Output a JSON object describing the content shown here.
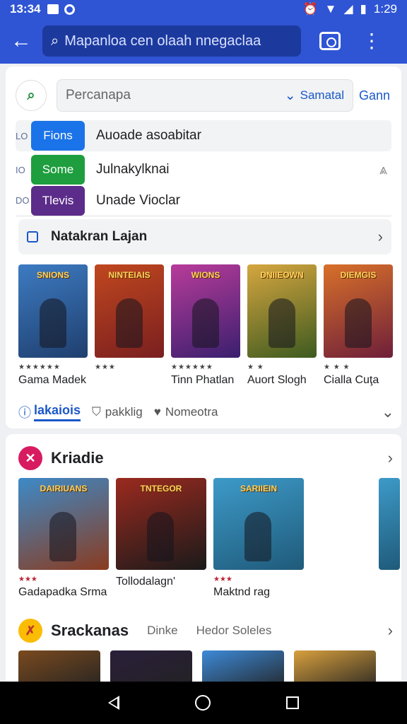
{
  "status": {
    "time": "13:34",
    "battery_time": "1:29"
  },
  "appbar": {
    "search_placeholder": "Mapanloa cen olaah nnegaclaa",
    "icons": [
      "back-arrow-icon",
      "search-icon",
      "camera-icon",
      "more-vert-icon"
    ]
  },
  "filter": {
    "placeholder": "Percanapa",
    "selected": "Samatal",
    "link": "Gann"
  },
  "tags": [
    {
      "mark": "LO",
      "label": "Fions",
      "color": "#1a73e8",
      "text": "Auoade asoabitar"
    },
    {
      "mark": "IO",
      "label": "Some",
      "color": "#1e9e3e",
      "text": "Julnakylknai"
    },
    {
      "mark": "DO",
      "label": "Tlevis",
      "color": "#5b2c8a",
      "text": "Unade Vioclar"
    }
  ],
  "section1": {
    "title": "Natakran Lajan"
  },
  "games1": [
    {
      "art_title": "SNIONS",
      "stars": "★★★★★★",
      "name": "Gama Madek",
      "bg": "#1f3f6e",
      "bg2": "#3d7bc2"
    },
    {
      "art_title": "NINTEIAIS",
      "stars": "★★★",
      "name": "",
      "bg": "#7a1f1f",
      "bg2": "#c0471f"
    },
    {
      "art_title": "WIONS",
      "stars": "★★★★★★",
      "name": "Tinn Phatlan",
      "bg": "#3a1f6e",
      "bg2": "#b83c9a"
    },
    {
      "art_title": "DNIIEOWN",
      "stars": "★ ★",
      "name": "Auort Slogh",
      "bg": "#3d5a1f",
      "bg2": "#d6a640"
    },
    {
      "art_title": "DIEMGIS",
      "stars": "★ ★ ★",
      "name": "Cialla Cuţa",
      "bg": "#6e1f3a",
      "bg2": "#d8702a"
    }
  ],
  "chips": {
    "active": "lakaiois",
    "chip1": "pakklig",
    "chip2": "Nomeotra"
  },
  "section2": {
    "title": "Kriadie",
    "badge": "✕"
  },
  "games2": [
    {
      "art_title": "DAIRIUANS",
      "stars": "★★★",
      "name": "Gadapadka Srma",
      "bg": "#8a3b1f",
      "bg2": "#3d8ac8"
    },
    {
      "art_title": "TNTEGOR",
      "stars": "",
      "name": "Tollodalagn'",
      "bg": "#1a1a1a",
      "bg2": "#9b2a1f"
    },
    {
      "art_title": "SARIIEIN",
      "stars": "★★★",
      "name": "Maktnd rag",
      "bg": "#1f5a7a",
      "bg2": "#3d9ac8"
    }
  ],
  "section3": {
    "title": "Srackanas",
    "chip1": "Dinke",
    "chip2": "Hedor Soleles"
  },
  "row3_colors": [
    "#7a4a1f",
    "#2a1f3a",
    "#3d8ad8",
    "#d8a03d"
  ]
}
